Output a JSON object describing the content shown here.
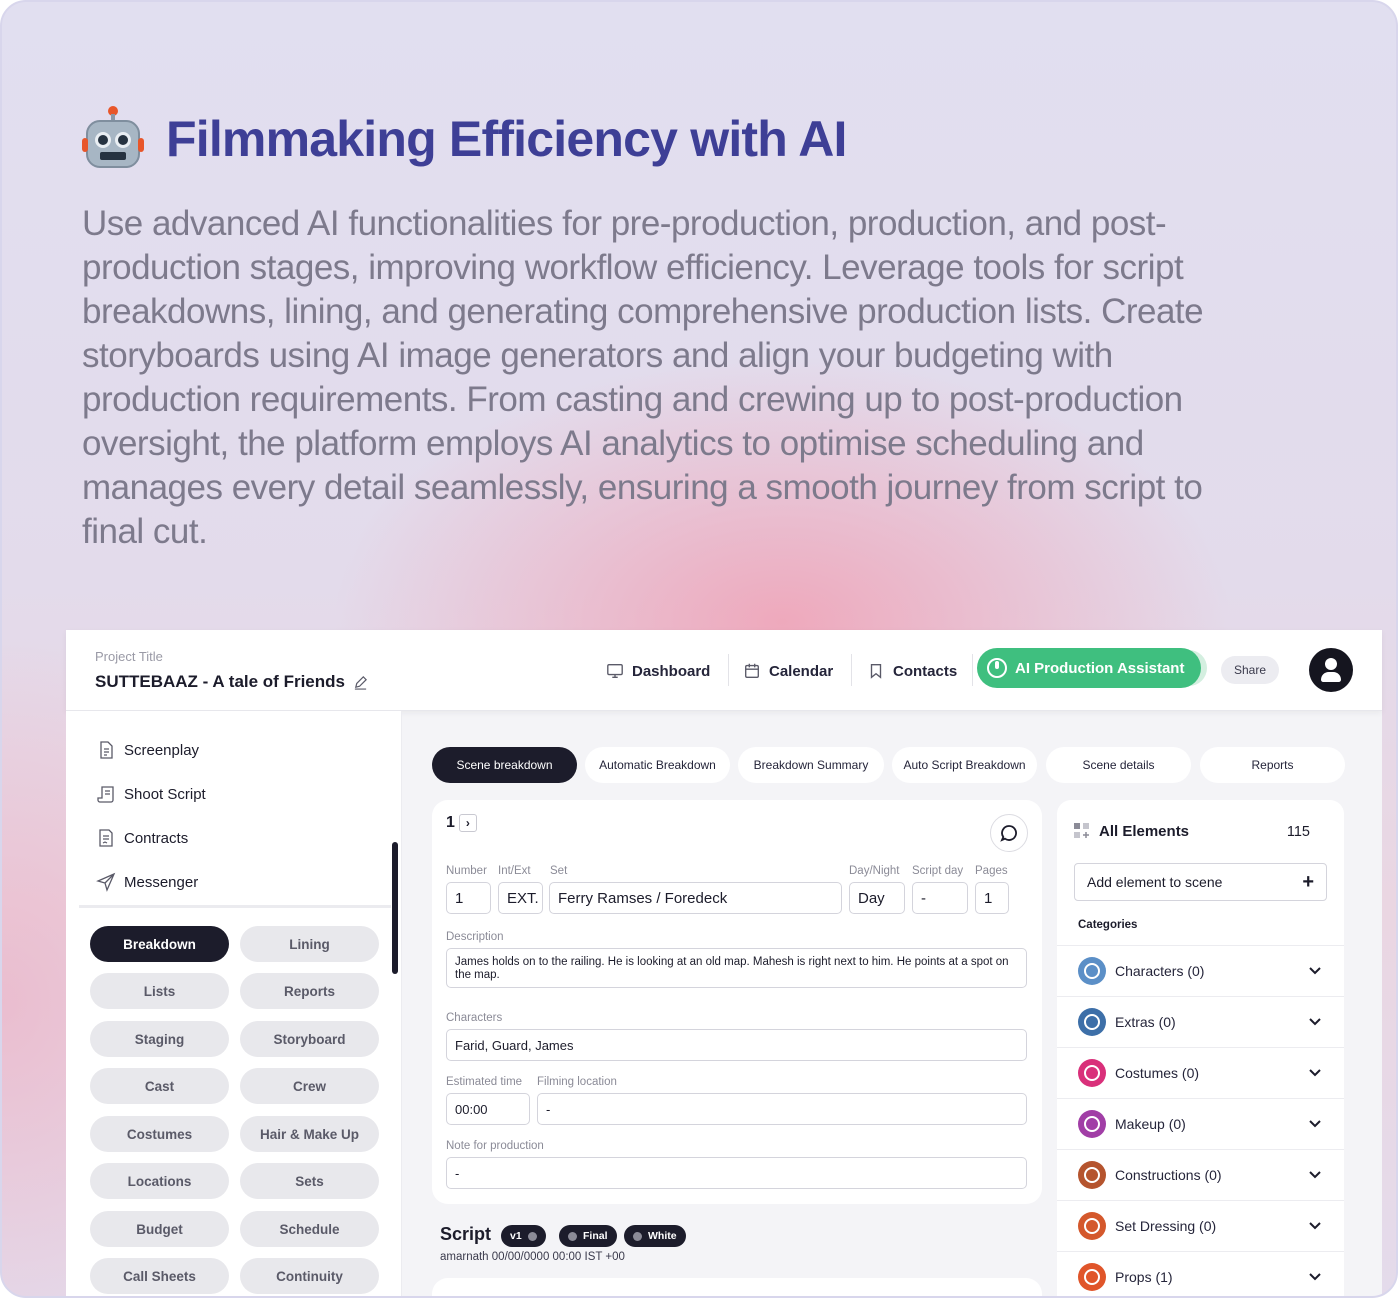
{
  "hero": {
    "title": "Filmmaking Efficiency with AI",
    "description": "Use advanced AI functionalities for pre-production, production, and post-production stages, improving workflow efficiency. Leverage tools for script breakdowns, lining, and generating comprehensive production lists. Create storyboards using AI image generators and align your budgeting with production requirements. From casting and crewing up to post-production oversight, the platform employs AI analytics to optimise scheduling and manages every detail seamlessly, ensuring a smooth journey from script to final cut.",
    "icon": "robot-icon"
  },
  "topbar": {
    "project_label": "Project Title",
    "project_title": "SUTTEBAAZ - A tale of Friends",
    "nav": {
      "dashboard": "Dashboard",
      "calendar": "Calendar",
      "contacts": "Contacts"
    },
    "ai_button": "AI Production Assistant",
    "share": "Share"
  },
  "sidebar": {
    "items": {
      "screenplay": "Screenplay",
      "shoot_script": "Shoot Script",
      "contracts": "Contracts",
      "messenger": "Messenger"
    },
    "modules": [
      "Breakdown",
      "Lining",
      "Lists",
      "Reports",
      "Staging",
      "Storyboard",
      "Cast",
      "Crew",
      "Costumes",
      "Hair & Make Up",
      "Locations",
      "Sets",
      "Budget",
      "Schedule",
      "Call Sheets",
      "Continuity"
    ],
    "active_module": "Breakdown"
  },
  "tabs": [
    "Scene breakdown",
    "Automatic Breakdown",
    "Breakdown Summary",
    "Auto Script Breakdown",
    "Scene details",
    "Reports"
  ],
  "scene": {
    "number": "1",
    "labels": {
      "number": "Number",
      "int_ext": "Int/Ext",
      "set": "Set",
      "day_night": "Day/Night",
      "script_day": "Script day",
      "pages": "Pages",
      "description": "Description",
      "characters": "Characters",
      "estimated_time": "Estimated time",
      "filming_location": "Filming location",
      "note": "Note for production"
    },
    "values": {
      "number": "1",
      "int_ext": "EXT.",
      "set": "Ferry Ramses / Foredeck",
      "day_night": "Day",
      "script_day": "-",
      "pages": "1",
      "description": "James holds on to the railing. He is looking at an old map. Mahesh is right next to him. He points at a spot on the map.",
      "characters": "Farid, Guard, James",
      "estimated_time": "00:00",
      "filming_location": "-",
      "note": "-"
    }
  },
  "script": {
    "title": "Script",
    "chips": [
      "v1",
      "Final",
      "White"
    ],
    "meta": "amarnath 00/00/0000 00:00 IST +00"
  },
  "elements": {
    "title": "All Elements",
    "count": "115",
    "add_label": "Add element to scene",
    "categories_label": "Categories",
    "categories": [
      {
        "label": "Characters (0)",
        "color": "#5b8fc7"
      },
      {
        "label": "Extras (0)",
        "color": "#3d6fa8"
      },
      {
        "label": "Costumes (0)",
        "color": "#d9307a"
      },
      {
        "label": "Makeup (0)",
        "color": "#a13ea6"
      },
      {
        "label": "Constructions (0)",
        "color": "#b5542e"
      },
      {
        "label": "Set Dressing (0)",
        "color": "#d4582c"
      },
      {
        "label": "Props (1)",
        "color": "#e0552a"
      }
    ]
  },
  "colors": {
    "accent_dark": "#1c1c2b",
    "ai_green": "#3fbf7f",
    "hero_title": "#3e3f96"
  }
}
